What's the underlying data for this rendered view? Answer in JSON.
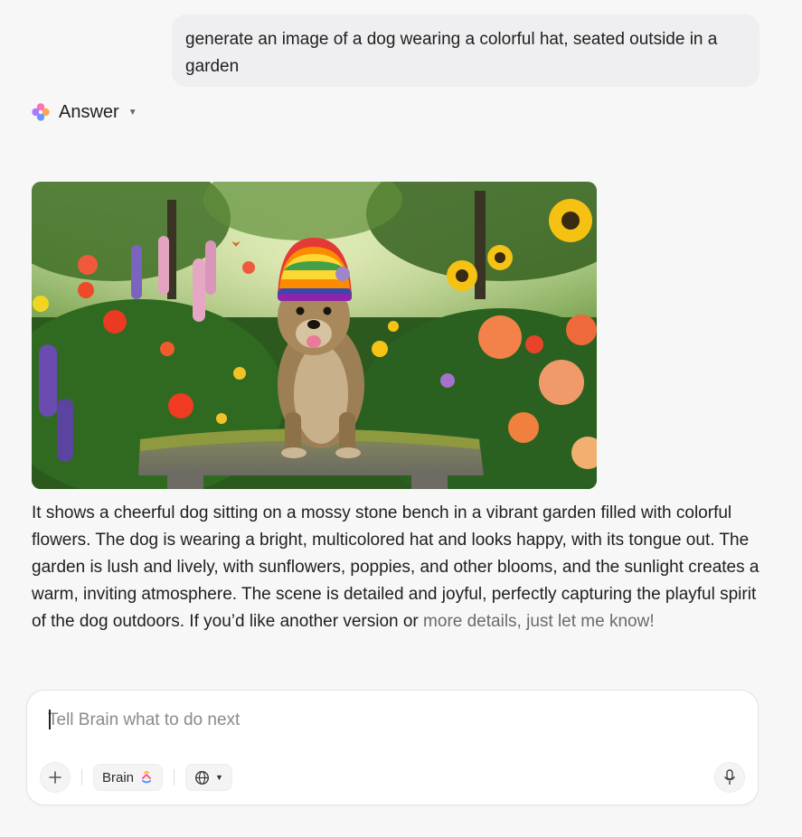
{
  "user_message": {
    "text": "generate an image of a dog wearing a colorful hat, seated outside in a garden"
  },
  "answer_header": {
    "icon": "brain-logo-icon",
    "label": "Answer",
    "caret_icon": "caret-down-icon"
  },
  "generated_image": {
    "description_icon": "generated-image"
  },
  "answer": {
    "text_main": "It shows a cheerful dog sitting on a mossy stone bench in a vibrant garden filled with colorful flowers. The dog is wearing a bright, multicolored hat and looks happy, with its tongue out. The garden is lush and lively, with sunflowers, poppies, and other blooms, and the sunlight creates a warm, inviting atmosphere. The scene is detailed and joyful, perfectly capturing the playful spirit of the dog outdoors. If you’d like another version or",
    "text_faded": "more details, just let me know!"
  },
  "composer": {
    "placeholder": "Tell Brain what to do next",
    "value": "",
    "add_icon": "plus-icon",
    "model_label": "Brain",
    "model_icon": "brain-logo-icon",
    "web_icon": "globe-icon",
    "web_caret_icon": "caret-down-icon",
    "mic_icon": "microphone-icon"
  },
  "colors": {
    "background": "#f7f7f8",
    "bubble": "#efeff1",
    "text": "#1f1f1f",
    "faded_text": "#6b6b6b",
    "placeholder": "#8a8a8f"
  }
}
